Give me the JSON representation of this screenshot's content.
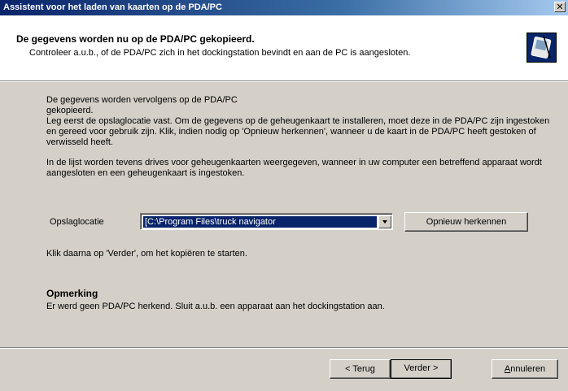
{
  "window": {
    "title": "Assistent voor het laden van kaarten op de PDA/PC",
    "close_symbol": "✕"
  },
  "header": {
    "heading": "De gegevens worden nu op de PDA/PC gekopieerd.",
    "subheading": "Controleer a.u.b., of de PDA/PC zich in het dockingstation bevindt en aan de PC is aangesloten.",
    "icon": "pda-icon"
  },
  "body": {
    "paragraph1": "De gegevens worden vervolgens op de PDA/PC gekopieerd.",
    "paragraph2": "Leg eerst de opslaglocatie vast. Om de gegevens op de geheugenkaart te installeren, moet deze in de PDA/PC zijn ingestoken en gereed voor gebruik zijn. Klik, indien nodig op 'Opnieuw herkennen', wanneer u de kaart in de PDA/PC heeft gestoken of verwisseld heeft.",
    "paragraph3": "In de lijst worden tevens drives voor geheugenkaarten weergegeven, wanneer in uw computer een betreffend apparaat wordt aangesloten en een geheugenkaart is ingestoken.",
    "storage_label": "Opslaglocatie",
    "storage_value": "[C:\\Program Files\\truck navigator",
    "recognize_button": "Opnieuw herkennen",
    "instruction": "Klik daarna op 'Verder', om het kopiëren te starten.",
    "note_title": "Opmerking",
    "note_text": "Er werd geen PDA/PC herkend. Sluit a.u.b. een apparaat aan het dockingstation aan."
  },
  "footer": {
    "back_button": "< Terug",
    "next_button": "Verder >",
    "cancel_button_first": "A",
    "cancel_button_rest": "nnuleren"
  },
  "colors": {
    "titlebar": "#0a246a",
    "selection": "#0a246a",
    "face": "#d4d0c8"
  }
}
